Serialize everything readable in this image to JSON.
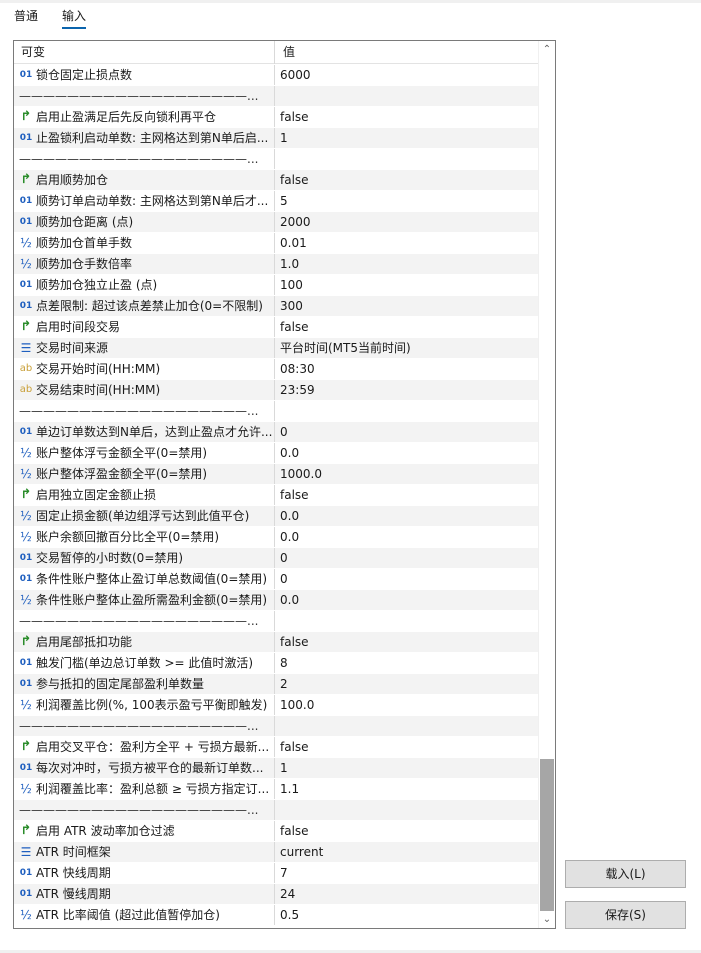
{
  "tabs": [
    {
      "label": "普通"
    },
    {
      "label": "输入"
    }
  ],
  "active_tab": "输入",
  "columns": {
    "name": "可变",
    "value": "值"
  },
  "rows": [
    {
      "icon": "int",
      "name": "锁仓固定止损点数",
      "value": "6000"
    },
    {
      "icon": "sep",
      "name": "———————————————————...",
      "value": ""
    },
    {
      "icon": "bool",
      "name": "启用止盈满足后先反向锁利再平仓",
      "value": "false"
    },
    {
      "icon": "int",
      "name": "止盈锁利启动单数: 主网格达到第N单后启...",
      "value": "1"
    },
    {
      "icon": "sep",
      "name": "———————————————————...",
      "value": ""
    },
    {
      "icon": "bool",
      "name": "启用顺势加仓",
      "value": "false"
    },
    {
      "icon": "int",
      "name": "顺势订单启动单数: 主网格达到第N单后才...",
      "value": "5"
    },
    {
      "icon": "int",
      "name": "顺势加仓距离 (点)",
      "value": "2000"
    },
    {
      "icon": "half",
      "name": "顺势加仓首单手数",
      "value": "0.01"
    },
    {
      "icon": "half",
      "name": "顺势加仓手数倍率",
      "value": "1.0"
    },
    {
      "icon": "int",
      "name": "顺势加仓独立止盈 (点)",
      "value": "100"
    },
    {
      "icon": "int",
      "name": "点差限制: 超过该点差禁止加仓(0=不限制)",
      "value": "300"
    },
    {
      "icon": "bool",
      "name": "启用时间段交易",
      "value": "false"
    },
    {
      "icon": "enum",
      "name": "交易时间来源",
      "value": "平台时间(MT5当前时间)"
    },
    {
      "icon": "str",
      "name": "交易开始时间(HH:MM)",
      "value": "08:30"
    },
    {
      "icon": "str",
      "name": "交易结束时间(HH:MM)",
      "value": "23:59"
    },
    {
      "icon": "sep",
      "name": "———————————————————...",
      "value": ""
    },
    {
      "icon": "int",
      "name": "单边订单数达到N单后，达到止盈点才允许...",
      "value": "0"
    },
    {
      "icon": "half",
      "name": "账户整体浮亏金额全平(0=禁用)",
      "value": "0.0"
    },
    {
      "icon": "half",
      "name": "账户整体浮盈金额全平(0=禁用)",
      "value": "1000.0"
    },
    {
      "icon": "bool",
      "name": "启用独立固定金额止损",
      "value": "false"
    },
    {
      "icon": "half",
      "name": "固定止损金额(单边组浮亏达到此值平仓)",
      "value": "0.0"
    },
    {
      "icon": "half",
      "name": "账户余额回撤百分比全平(0=禁用)",
      "value": "0.0"
    },
    {
      "icon": "int",
      "name": "交易暂停的小时数(0=禁用)",
      "value": "0"
    },
    {
      "icon": "int",
      "name": "条件性账户整体止盈订单总数阈值(0=禁用)",
      "value": "0"
    },
    {
      "icon": "half",
      "name": "条件性账户整体止盈所需盈利金额(0=禁用)",
      "value": "0.0"
    },
    {
      "icon": "sep",
      "name": "———————————————————...",
      "value": ""
    },
    {
      "icon": "bool",
      "name": "启用尾部抵扣功能",
      "value": "false"
    },
    {
      "icon": "int",
      "name": "触发门槛(单边总订单数 >= 此值时激活)",
      "value": "8"
    },
    {
      "icon": "int",
      "name": "参与抵扣的固定尾部盈利单数量",
      "value": "2"
    },
    {
      "icon": "half",
      "name": "利润覆盖比例(%, 100表示盈亏平衡即触发)",
      "value": "100.0"
    },
    {
      "icon": "sep",
      "name": "———————————————————...",
      "value": ""
    },
    {
      "icon": "bool",
      "name": "启用交叉平仓：盈利方全平 + 亏损方最新...",
      "value": "false"
    },
    {
      "icon": "int",
      "name": "每次对冲时，亏损方被平仓的最新订单数...",
      "value": "1"
    },
    {
      "icon": "half",
      "name": "利润覆盖比率：盈利总额 ≥ 亏损方指定订...",
      "value": "1.1"
    },
    {
      "icon": "sep",
      "name": "———————————————————...",
      "value": ""
    },
    {
      "icon": "bool",
      "name": "启用 ATR 波动率加仓过滤",
      "value": "false"
    },
    {
      "icon": "enum",
      "name": "ATR 时间框架",
      "value": "current"
    },
    {
      "icon": "int",
      "name": "ATR 快线周期",
      "value": "7"
    },
    {
      "icon": "int",
      "name": "ATR 慢线周期",
      "value": "24"
    },
    {
      "icon": "half",
      "name": "ATR 比率阈值 (超过此值暂停加仓)",
      "value": "0.5"
    }
  ],
  "icon_glyphs": {
    "int": "01",
    "bool": "↱",
    "half": "½",
    "enum": "☰",
    "str": "ab",
    "sep": ""
  },
  "buttons": {
    "load": "载入(L)",
    "save": "保存(S)"
  },
  "colors": {
    "accent": "#0a64ad",
    "int_icon": "#1f5fbf",
    "bool_icon": "#2a8c2a",
    "str_icon": "#c9a03a",
    "scroll_thumb": "#a6a6a6"
  }
}
